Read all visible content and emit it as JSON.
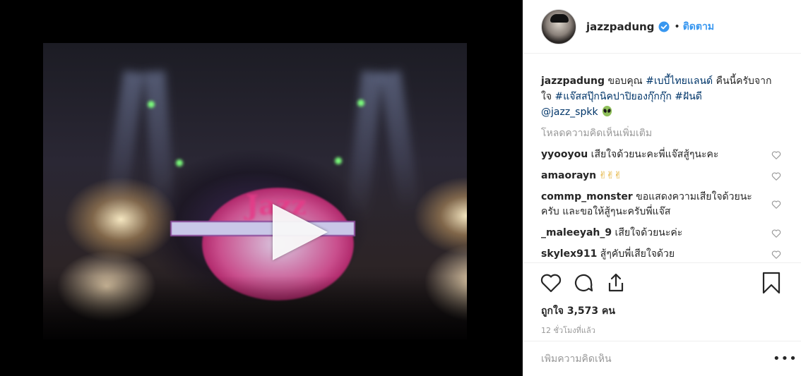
{
  "post": {
    "username": "jazzpadung",
    "follow_separator": "•",
    "follow_label": "ติดตาม"
  },
  "caption": {
    "username": "jazzpadung",
    "text_1": " ขอบคุณ ",
    "tag_1": "#เบบี้ไทยแลนด์",
    "text_2": " คืนนี้ครับจากใจ ",
    "tag_2": "#แจ๊สสปุ๊กนิคปาปิยองกุ๊กกุ๊ก",
    "text_3": " ",
    "tag_3": "#ฝันดี",
    "mention": "@jazz_spkk"
  },
  "load_more_label": "โหลดความคิดเห็นเพิ่มเติม",
  "comments": [
    {
      "username": "yyooyou",
      "text": " เสียใจด้วยนะคะพี่แจ๊สสู้ๆนะคะ"
    },
    {
      "username": "amaorayn",
      "text": " ✌✌✌"
    },
    {
      "username": "commp_monster",
      "text": " ขอแสดงความเสียใจด้วยนะครับ และขอให้สู้ๆนะครับพี่แจ๊ส"
    },
    {
      "username": "_maleeyah_9",
      "text": " เสียใจด้วยนะค่ะ"
    },
    {
      "username": "skylex911",
      "text": " สู้ๆคับพี่เสียใจด้วย"
    }
  ],
  "likes_label": "ถูกใจ 3,573 คน",
  "timestamp": "12 ชั่วโมงที่แล้ว",
  "add_comment_placeholder": "เพิ่มความคิดเห็น",
  "more_label": "•••",
  "icons": {
    "play": "play-icon",
    "verified": "verified-badge-icon",
    "like": "heart-icon",
    "comment": "comment-icon",
    "share": "share-icon",
    "save": "bookmark-icon"
  },
  "colors": {
    "link": "#3897f0",
    "hashtag": "#003569",
    "muted": "#999999"
  }
}
